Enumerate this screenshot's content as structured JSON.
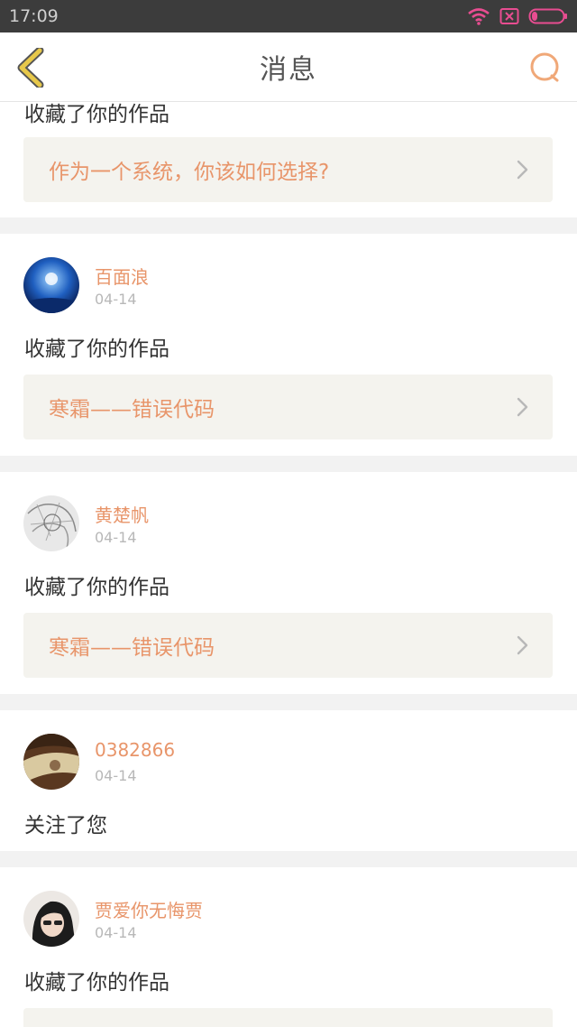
{
  "status": {
    "time": "17:09"
  },
  "nav": {
    "title": "消息"
  },
  "top_partial": {
    "action": "收藏了你的作品",
    "work": "作为一个系统，你该如何选择?"
  },
  "messages": [
    {
      "name": "百面浪",
      "date": "04-14",
      "action": "收藏了你的作品",
      "work": "寒霜——错误代码"
    },
    {
      "name": "黄楚帆",
      "date": "04-14",
      "action": "收藏了你的作品",
      "work": "寒霜——错误代码"
    },
    {
      "name": "0382866",
      "date": "04-14",
      "action": "关注了您"
    },
    {
      "name": "贾爱你无悔贾",
      "date": "04-14",
      "action": "收藏了你的作品"
    }
  ],
  "colors": {
    "accent": "#e8956a",
    "back_icon": "#e7c84a",
    "status_icon": "#e84d91"
  }
}
